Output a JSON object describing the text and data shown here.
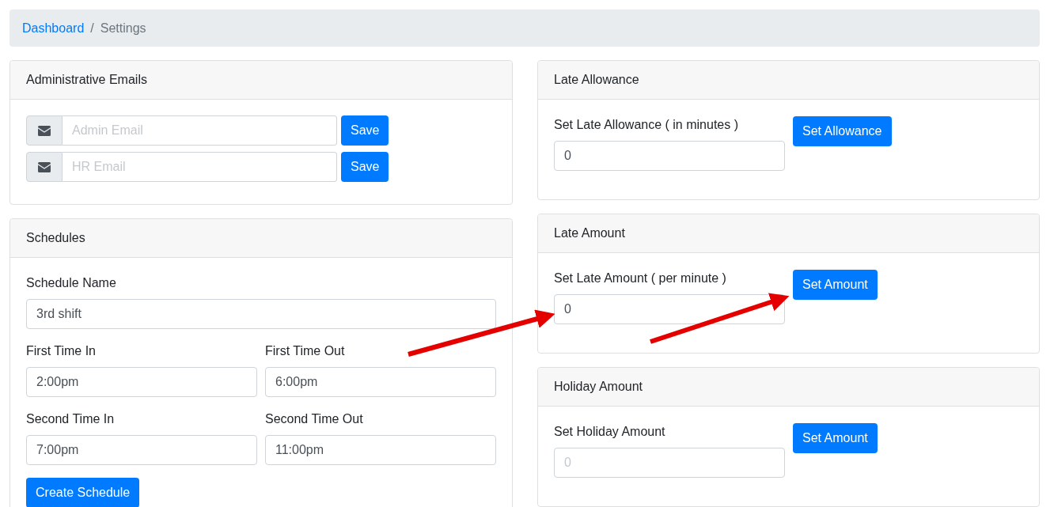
{
  "breadcrumb": [
    {
      "label": "Dashboard",
      "kind": "link"
    },
    {
      "label": "/",
      "kind": "separator"
    },
    {
      "label": "Settings",
      "kind": "current"
    }
  ],
  "admin_emails": {
    "title": "Administrative Emails",
    "fields": [
      {
        "placeholder": "Admin Email",
        "button": "Save"
      },
      {
        "placeholder": "HR Email",
        "button": "Save"
      }
    ]
  },
  "schedules": {
    "title": "Schedules",
    "name": {
      "label": "Schedule Name",
      "value": "3rd shift"
    },
    "times": [
      {
        "label": "First Time In",
        "value": "2:00pm"
      },
      {
        "label": "First Time Out",
        "value": "6:00pm"
      },
      {
        "label": "Second Time In",
        "value": "7:00pm"
      },
      {
        "label": "Second Time Out",
        "value": "11:00pm"
      }
    ],
    "button": "Create Schedule"
  },
  "settings_cards": [
    {
      "title": "Late Allowance",
      "label": "Set Late Allowance ( in minutes )",
      "value": "0",
      "button": "Set Allowance"
    },
    {
      "title": "Late Amount",
      "label": "Set Late Amount ( per minute )",
      "value": "0",
      "button": "Set Amount"
    },
    {
      "title": "Holiday Amount",
      "label": "Set Holiday Amount",
      "placeholder": "0",
      "button": "Set Amount"
    }
  ]
}
